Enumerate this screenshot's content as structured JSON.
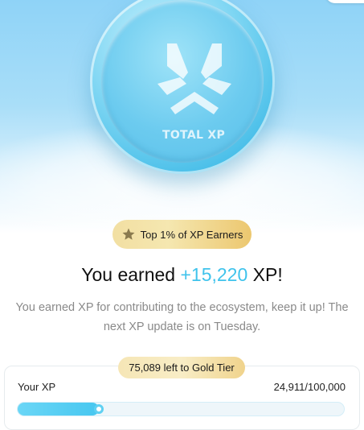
{
  "hero": {
    "coin_label": "TOTAL XP",
    "logo_icon": "tristar-logo-icon"
  },
  "badge": {
    "icon": "star-icon",
    "text": "Top 1% of XP Earners",
    "colors": {
      "gold_start": "#f2dfa2",
      "gold_end": "#ecc76f"
    }
  },
  "headline": {
    "prefix": "You earned ",
    "value": "+15,220",
    "suffix": " XP!",
    "accent_color": "#3fc3ec"
  },
  "description": {
    "line1": "You earned XP for contributing to the ecosystem, keep it up! The",
    "line2": "next XP update is on Tuesday."
  },
  "progress": {
    "tier_text": "75,089 left to Gold Tier",
    "label": "Your XP",
    "count_text": "24,911/100,000",
    "current": 24911,
    "max": 100000,
    "bar_color": "#47c7f0"
  }
}
